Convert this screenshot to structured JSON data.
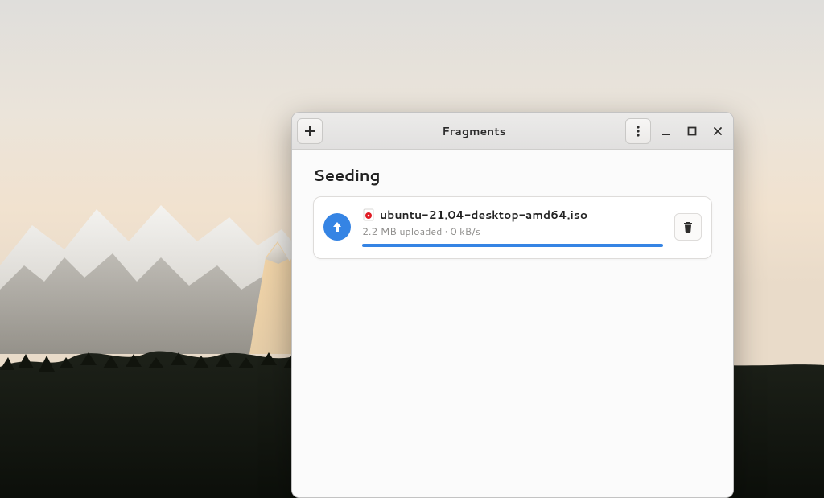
{
  "window_title": "Fragments",
  "section_heading": "Seeding",
  "torrent": {
    "filename": "ubuntu-21.04-desktop-amd64.iso",
    "status_line": "2.2 MB uploaded · 0 kB/s"
  }
}
